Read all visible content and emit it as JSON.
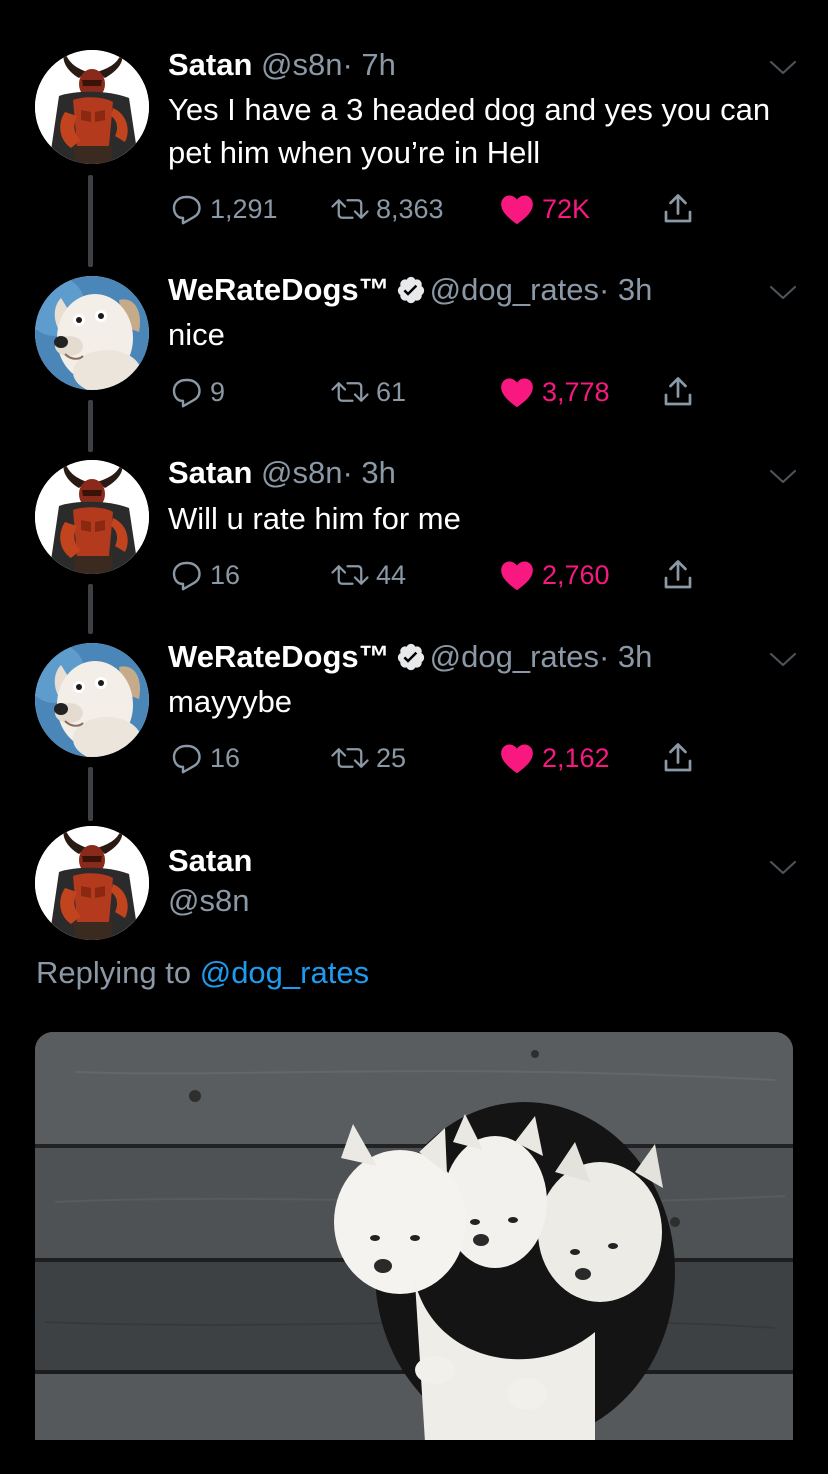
{
  "tweets": [
    {
      "name": "Satan",
      "handle": "@s8n",
      "time": "· 7h",
      "verified": false,
      "text": "Yes I have a 3 headed dog and yes you can pet him when you’re in Hell",
      "replies": "1,291",
      "retweets": "8,363",
      "likes": "72K",
      "avatar": "satan-avatar"
    },
    {
      "name": "WeRateDogs™",
      "handle": "@dog_rates",
      "time": "· 3h",
      "verified": true,
      "text": "nice",
      "replies": "9",
      "retweets": "61",
      "likes": "3,778",
      "avatar": "dog-avatar"
    },
    {
      "name": "Satan",
      "handle": "@s8n",
      "time": "· 3h",
      "verified": false,
      "text": "Will u rate him for me",
      "replies": "16",
      "retweets": "44",
      "likes": "2,760",
      "avatar": "satan-avatar"
    },
    {
      "name": "WeRateDogs™",
      "handle": "@dog_rates",
      "time": "· 3h",
      "verified": true,
      "text": "mayyybe",
      "replies": "16",
      "retweets": "25",
      "likes": "2,162",
      "avatar": "dog-avatar"
    }
  ],
  "main_tweet": {
    "name": "Satan",
    "handle": "@s8n",
    "replying_prefix": "Replying to",
    "replying_link": "@dog_rates",
    "media_alt": "three white puppies peeking out of a hole in a wooden wall"
  },
  "colors": {
    "background": "#000000",
    "secondary_text": "#8b98a5",
    "like_pink": "#f91880",
    "link_blue": "#1d9bf0"
  }
}
